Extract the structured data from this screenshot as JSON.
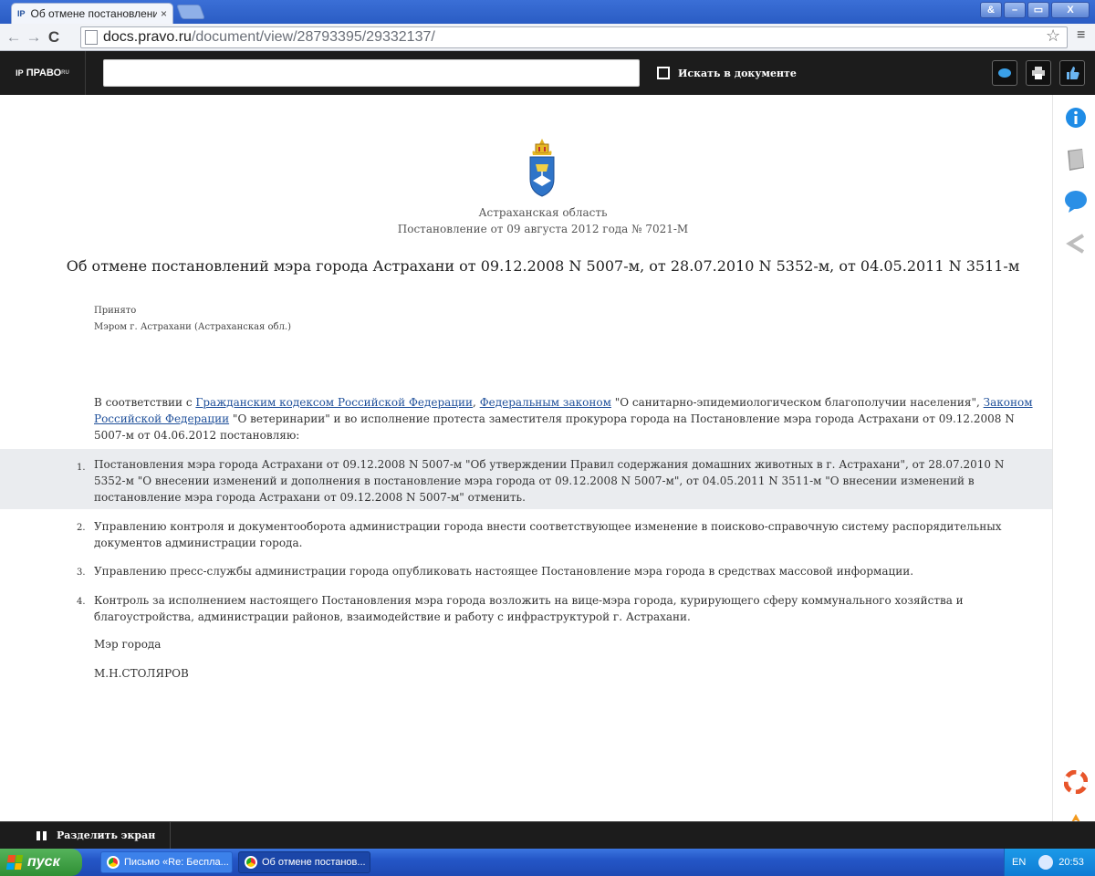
{
  "browser": {
    "tab_title": "Об отмене постановлений м",
    "tab_close": "×",
    "tab_favicon": "IP",
    "url_host": "docs.pravo.ru",
    "url_path": "/document/view/28793395/29332137/",
    "back_icon": "←",
    "forward_icon": "→",
    "reload_icon": "C",
    "star_icon": "☆",
    "menu_icon": "≡",
    "window_buttons": [
      "&",
      "–",
      "▭",
      "X"
    ]
  },
  "site": {
    "logo_text": "ПРАВО",
    "logo_sup": "RU",
    "search_value": "",
    "search_in_document_label": "Искать в документе"
  },
  "document": {
    "region": "Астраханская область",
    "decree": "Постановление от 09 августа 2012 года № 7021-М",
    "title": "Об отмене постановлений мэра города Астрахани от 09.12.2008 N 5007-м, от 28.07.2010 N 5352-м, от 04.05.2011 N 3511-м",
    "accepted_label": "Принято",
    "accepted_by": "Мэром г. Астрахани (Астраханская обл.)",
    "preamble": {
      "t1": "В соответствии с ",
      "link1": "Гражданским кодексом Российской Федерации",
      "t2": ", ",
      "link2": "Федеральным законом",
      "t3": " \"О санитарно-эпидемиологическом благополучии населения\", ",
      "link3": "Законом Российской Федерации",
      "t4": " \"О ветеринарии\" и во исполнение протеста заместителя прокурора города на Постановление мэра города Астрахани от 09.12.2008 N 5007-м от 04.06.2012 постановляю:"
    },
    "items": [
      {
        "num": "1.",
        "text": "Постановления мэра города Астрахани от 09.12.2008 N 5007-м \"Об утверждении Правил содержания домашних животных в г. Астрахани\", от 28.07.2010 N 5352-м \"О внесении изменений и дополнения в постановление мэра города от 09.12.2008 N 5007-м\", от 04.05.2011 N 3511-м \"О внесении изменений в постановление мэра города Астрахани от 09.12.2008 N 5007-м\" отменить."
      },
      {
        "num": "2.",
        "text": "Управлению контроля и документооборота администрации города внести соответствующее изменение в поисково-справочную систему распорядительных документов администрации города."
      },
      {
        "num": "3.",
        "text": "Управлению пресс-службы администрации города опубликовать настоящее Постановление мэра города в средствах массовой информации."
      },
      {
        "num": "4.",
        "text": "Контроль за исполнением настоящего Постановления мэра города возложить на вице-мэра города, курирующего сферу коммунального хозяйства и благоустройства, администрации районов, взаимодействие и работу с инфраструктурой г. Астрахани."
      }
    ],
    "signature_role": "Мэр города",
    "signature_name": "М.Н.СТОЛЯРОВ"
  },
  "bottombar": {
    "split_screen_label": "Разделить экран"
  },
  "taskbar": {
    "start_label": "пуск",
    "tasks": [
      "Письмо «Re: Беспла...",
      "Об отмене постанов..."
    ],
    "lang": "EN",
    "time": "20:53"
  },
  "colors": {
    "link": "#1e4f9a",
    "header_bg": "#1c1c1c",
    "shade": "#eaecef"
  }
}
